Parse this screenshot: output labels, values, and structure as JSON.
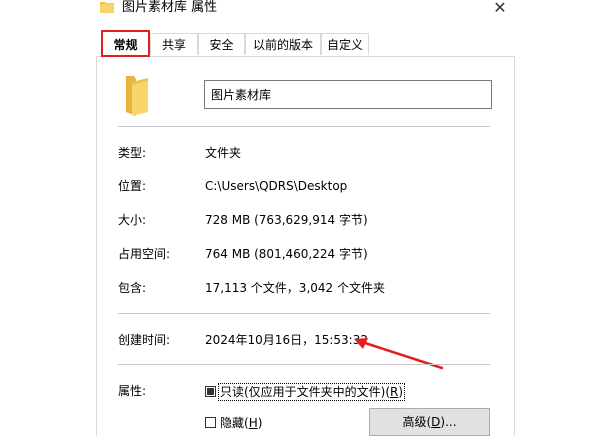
{
  "window": {
    "title": "图片素材库 属性",
    "close_label": "✕"
  },
  "tabs": [
    {
      "label": "常规",
      "active": true
    },
    {
      "label": "共享",
      "active": false
    },
    {
      "label": "安全",
      "active": false
    },
    {
      "label": "以前的版本",
      "active": false
    },
    {
      "label": "自定义",
      "active": false
    }
  ],
  "general": {
    "folder_name": "图片素材库",
    "type_label": "类型:",
    "type_value": "文件夹",
    "location_label": "位置:",
    "location_value": "C:\\Users\\QDRS\\Desktop",
    "size_label": "大小:",
    "size_value": "728 MB (763,629,914 字节)",
    "size_on_disk_label": "占用空间:",
    "size_on_disk_value": "764 MB (801,460,224 字节)",
    "contains_label": "包含:",
    "contains_value": "17,113 个文件，3,042 个文件夹",
    "created_label": "创建时间:",
    "created_value": "2024年10月16日，15:53:32",
    "attributes_label": "属性:",
    "readonly": {
      "label_prefix": "只读(仅应用于文件夹中的文件)(",
      "accel": "R",
      "label_suffix": ")",
      "state": "indeterminate"
    },
    "hidden": {
      "label_prefix": "隐藏(",
      "accel": "H",
      "label_suffix": ")",
      "state": "unchecked"
    },
    "advanced_button": {
      "label_prefix": "高级(",
      "accel": "D",
      "label_suffix": ")..."
    }
  },
  "annotation": {
    "arrow_color": "#e02020",
    "tab_highlight_color": "#e02020"
  },
  "icons": {
    "title_icon": "folder-icon",
    "big_icon": "folder-icon"
  }
}
